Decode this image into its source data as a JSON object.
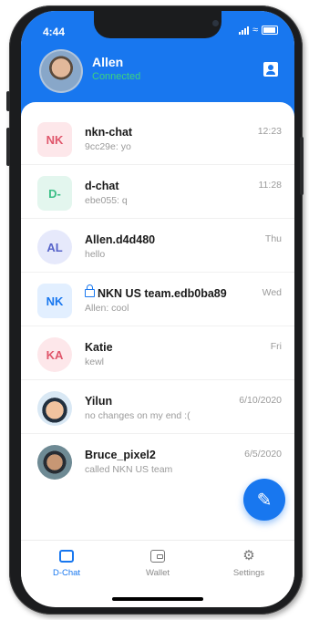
{
  "status_bar": {
    "time": "4:44"
  },
  "header": {
    "user_name": "Allen",
    "user_status": "Connected"
  },
  "conversations": [
    {
      "initials": "NK",
      "title": "nkn-chat",
      "preview": "9cc29e: yo",
      "time": "12:23",
      "badge_bg": "#fde7ea",
      "badge_fg": "#e0566b"
    },
    {
      "initials": "D-",
      "title": "d-chat",
      "preview": "ebe055: q",
      "time": "11:28",
      "badge_bg": "#e3f6ee",
      "badge_fg": "#3bbf86"
    },
    {
      "initials": "AL",
      "title": "Allen.d4d480",
      "preview": "hello",
      "time": "Thu",
      "badge_bg": "#e6e9fb",
      "badge_fg": "#5663c9"
    },
    {
      "initials": "NK",
      "title": "NKN US team.edb0ba89",
      "preview": "Allen: cool",
      "time": "Wed",
      "badge_bg": "#e2efff",
      "badge_fg": "#1877ef",
      "private": true
    },
    {
      "initials": "KA",
      "title": "Katie",
      "preview": "kewl",
      "time": "Fri",
      "badge_bg": "#fde7ea",
      "badge_fg": "#e0566b"
    },
    {
      "initials": "",
      "title": "Yilun",
      "preview": "no changes on my end :(",
      "time": "6/10/2020"
    },
    {
      "initials": "",
      "title": "Bruce_pixel2",
      "preview": "called NKN US team",
      "time": "6/5/2020"
    }
  ],
  "tabs": [
    {
      "label": "D-Chat",
      "icon": "chat-icon",
      "active": true
    },
    {
      "label": "Wallet",
      "icon": "wallet-icon",
      "active": false
    },
    {
      "label": "Settings",
      "icon": "gear-icon",
      "active": false
    }
  ],
  "colors": {
    "accent": "#1877ef",
    "online": "#3cd37e"
  }
}
